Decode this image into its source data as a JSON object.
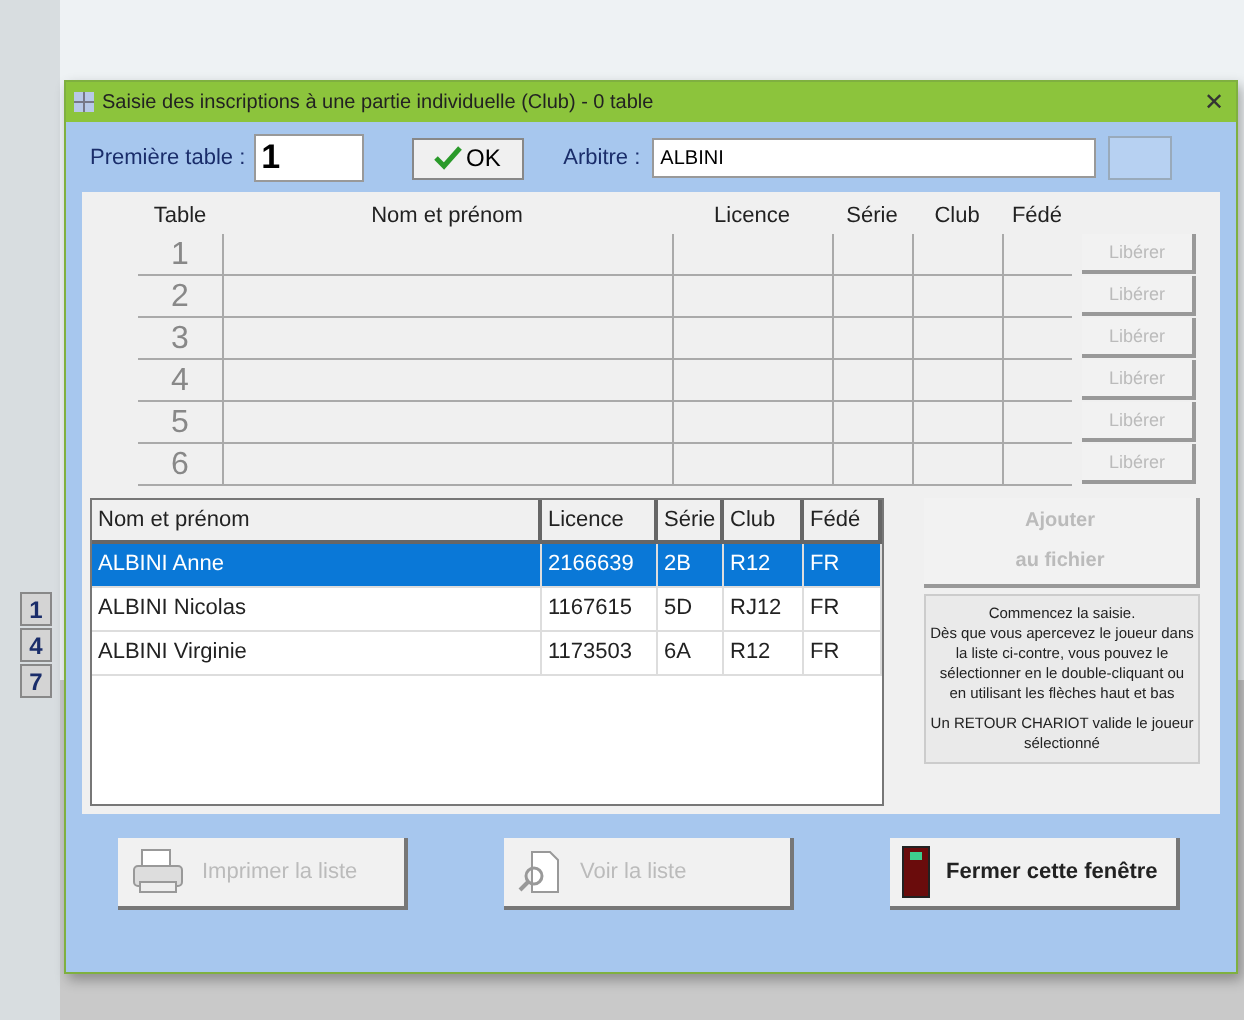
{
  "side_keys": [
    "1",
    "4",
    "7"
  ],
  "window": {
    "title": "Saisie des inscriptions à une partie individuelle (Club) - 0 table",
    "close": "✕"
  },
  "top_bar": {
    "first_table_label": "Première table :",
    "first_table_value": "1",
    "ok_button": "OK",
    "referee_label": "Arbitre :",
    "referee_value": "ALBINI"
  },
  "tables": {
    "columns": [
      "Table",
      "Nom et prénom",
      "Licence",
      "Série",
      "Club",
      "Fédé"
    ],
    "rows": [
      {
        "number": "1",
        "release": "Libérer",
        "disabled": true
      },
      {
        "number": "2",
        "release": "Libérer",
        "disabled": true
      },
      {
        "number": "3",
        "release": "Libérer",
        "disabled": true
      },
      {
        "number": "4",
        "release": "Libérer",
        "disabled": true
      },
      {
        "number": "5",
        "release": "Libérer",
        "disabled": true
      },
      {
        "number": "6",
        "release": "Libérer",
        "disabled": true
      }
    ]
  },
  "players": {
    "columns": [
      "Nom et prénom",
      "Licence",
      "Série",
      "Club",
      "Fédé"
    ],
    "rows": [
      {
        "cells": [
          "ALBINI Anne",
          "2166639",
          "2B",
          "R12",
          "FR"
        ],
        "selected": true
      },
      {
        "cells": [
          "ALBINI Nicolas",
          "1167615",
          "5D",
          "RJ12",
          "FR"
        ],
        "selected": false
      },
      {
        "cells": [
          "ALBINI Virginie",
          "1173503",
          "6A",
          "R12",
          "FR"
        ],
        "selected": false
      }
    ]
  },
  "add_button": {
    "lines": [
      "Ajouter",
      "au fichier"
    ],
    "disabled": true
  },
  "help": {
    "paragraphs": [
      "Commencez la saisie.\nDès que vous apercevez le joueur dans la liste ci-contre, vous pouvez le sélectionner en le double-cliquant ou en utilisant les flèches haut et bas",
      "Un RETOUR CHARIOT valide le joueur sélectionné"
    ]
  },
  "buttons": [
    {
      "kind": "print",
      "label": "Imprimer la liste",
      "disabled": true
    },
    {
      "kind": "view",
      "label": "Voir la liste",
      "disabled": true
    },
    {
      "kind": "close",
      "label": "Fermer cette fenêtre",
      "disabled": false
    }
  ]
}
